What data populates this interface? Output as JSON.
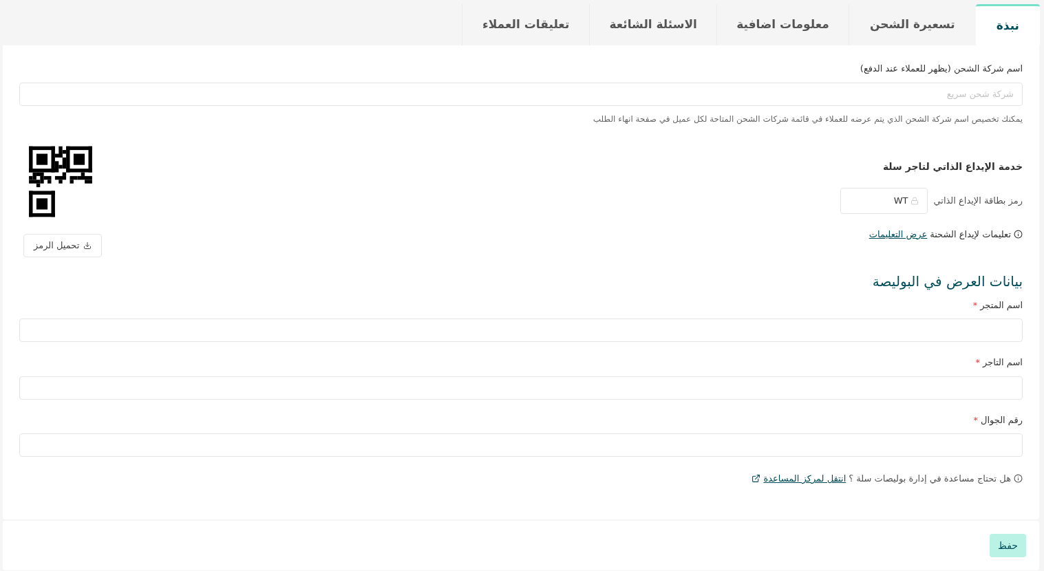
{
  "tabs": [
    {
      "label": "نبذة",
      "selected": true
    },
    {
      "label": "تسعيرة الشحن",
      "selected": false
    },
    {
      "label": "معلومات اضافية",
      "selected": false
    },
    {
      "label": "الاسئلة الشائعة",
      "selected": false
    },
    {
      "label": "تعليقات العملاء",
      "selected": false
    }
  ],
  "company_name": {
    "label": "اسم شركة الشحن (يظهر للعملاء عند الدفع)",
    "placeholder": "شركة شحن سريع",
    "hint": "يمكنك تخصيص اسم شركة الشحن الذي يتم عرضه للعملاء في قائمة شركات الشحن المتاحة لكل عميل في صفحة انهاء الطلب"
  },
  "self_drop": {
    "title": "خدمة الإيداع الذاتي لتاجر سلة",
    "code_label": "رمز بطاقة الإيداع الذاتي",
    "code_value": "WT",
    "instructions": "تعليمات لإيداع الشحنة",
    "instructions_link": "عرض التعليمات",
    "download_button": "تحميل الرمز"
  },
  "policy": {
    "title": "بيانات العرض في البوليصة",
    "fields": [
      {
        "label": "اسم المتجر",
        "required": true
      },
      {
        "label": "اسم التاجر",
        "required": true
      },
      {
        "label": "رقم الجوال",
        "required": true
      }
    ],
    "required_mark": "*",
    "help_text": "هل تحتاج مساعدة في إدارة بوليصات سلة ؟",
    "help_link": "انتقل لمركز المساعدة"
  },
  "save_button": "حفظ"
}
